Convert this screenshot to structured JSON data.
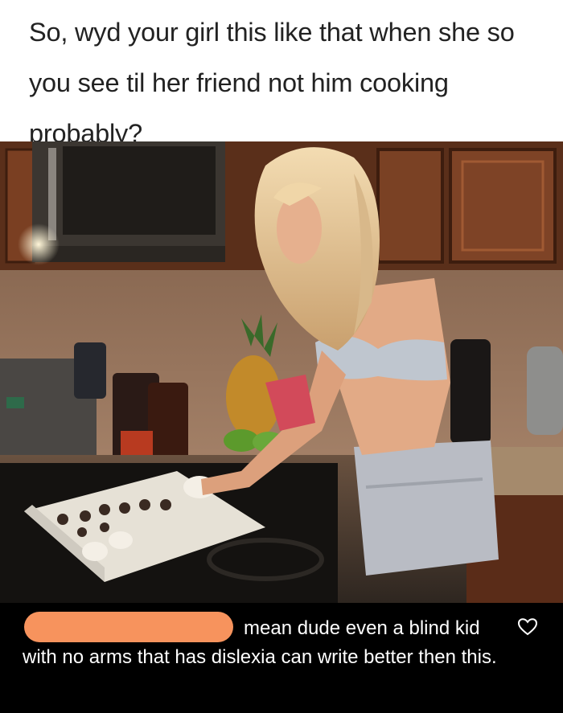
{
  "caption": {
    "text": "So, wyd your girl this like that when she so you see til her friend not him cooking probably?"
  },
  "comment": {
    "text": "mean dude even a blind kid with no arms that has dislexia can write better then this.",
    "redaction_color": "#f7935d"
  },
  "colors": {
    "caption_bg": "#ffffff",
    "comment_bg": "#000000",
    "comment_text": "#ffffff"
  }
}
